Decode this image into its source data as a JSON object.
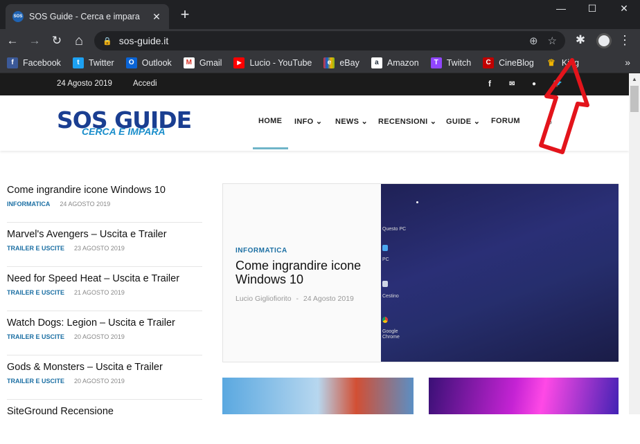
{
  "browser": {
    "tab": {
      "favicon_text": "SOS",
      "title": "SOS Guide - Cerca e impara",
      "close": "✕"
    },
    "new_tab": "+",
    "window": {
      "minimize": "—",
      "maximize": "☐",
      "close": "✕"
    },
    "nav": {
      "back": "←",
      "forward": "→",
      "reload": "↻",
      "home": "⌂"
    },
    "omnibox": {
      "lock": "🔒",
      "url": "sos-guide.it",
      "install": "⊕",
      "bookmark": "☆"
    },
    "extensions": "✱",
    "menu": "⋮",
    "bookmarks": [
      {
        "label": "Facebook",
        "icon": "f",
        "color": "#3b5998"
      },
      {
        "label": "Twitter",
        "icon": "t",
        "color": "#1da1f2"
      },
      {
        "label": "Outlook",
        "icon": "O",
        "color": "#0a64d6"
      },
      {
        "label": "Gmail",
        "icon": "M",
        "color": "#d93025"
      },
      {
        "label": "Lucio - YouTube",
        "icon": "▶",
        "color": "#ff0000"
      },
      {
        "label": "eBay",
        "icon": "e",
        "color": "#e53238"
      },
      {
        "label": "Amazon",
        "icon": "a",
        "color": "#232f3e"
      },
      {
        "label": "Twitch",
        "icon": "T",
        "color": "#9146ff"
      },
      {
        "label": "CineBlog",
        "icon": "C",
        "color": "#c00000"
      },
      {
        "label": "King",
        "icon": "♛",
        "color": "#d4a017"
      }
    ],
    "bookmarks_more": "»"
  },
  "site": {
    "topbar": {
      "date": "24 Agosto 2019",
      "login": "Accedi",
      "social": [
        "f",
        "✉",
        "●",
        "🐦"
      ]
    },
    "logo": {
      "main": "SOS GUIDE",
      "tagline": "CERCA E IMPARA"
    },
    "menu": [
      "HOME",
      "INFO ⌄",
      "NEWS ⌄",
      "RECENSIONI ⌄",
      "GUIDE ⌄",
      "FORUM"
    ],
    "search_icon": "⌕",
    "articles": [
      {
        "title": "Come ingrandire icone Windows 10",
        "category": "INFORMATICA",
        "date": "24 AGOSTO 2019"
      },
      {
        "title": "Marvel's Avengers – Uscita e Trailer",
        "category": "TRAILER E USCITE",
        "date": "23 AGOSTO 2019"
      },
      {
        "title": "Need for Speed Heat – Uscita e Trailer",
        "category": "TRAILER E USCITE",
        "date": "21 AGOSTO 2019"
      },
      {
        "title": "Watch Dogs: Legion – Uscita e Trailer",
        "category": "TRAILER E USCITE",
        "date": "20 AGOSTO 2019"
      },
      {
        "title": "Gods & Monsters – Uscita e Trailer",
        "category": "TRAILER E USCITE",
        "date": "20 AGOSTO 2019"
      },
      {
        "title": "SiteGround Recensione",
        "category": "",
        "date": ""
      }
    ],
    "featured": {
      "category": "INFORMATICA",
      "title": "Come ingrandire icone Windows 10",
      "author": "Lucio Gigliofiorito",
      "separator": "-",
      "date": "24 Agosto 2019",
      "desktop_labels": [
        "Questo PC",
        "PC",
        "Cestino",
        "Google Chrome"
      ]
    }
  }
}
